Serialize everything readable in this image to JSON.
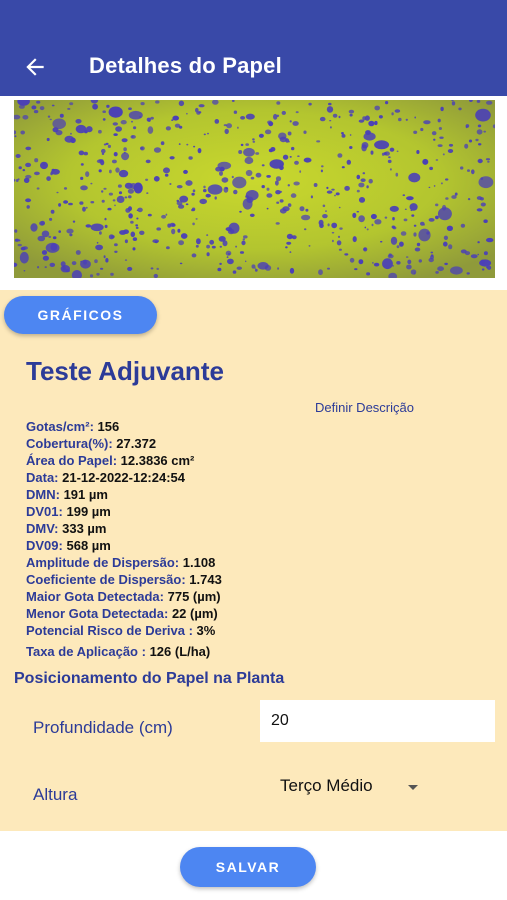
{
  "appbar": {
    "title": "Detalhes do Papel",
    "back_icon": "arrow-left-icon",
    "color": "#3949a8"
  },
  "photo": {
    "description_colors": {
      "background": "#b4c830",
      "droplets": "#4a3fb8"
    }
  },
  "charts_button": {
    "label": "GRÁFICOS"
  },
  "test_name": "Teste Adjuvante",
  "description_link": "Definir Descrição",
  "stats": [
    {
      "label": "Gotas/cm²:",
      "value": "156"
    },
    {
      "label": "Cobertura(%):",
      "value": "27.372"
    },
    {
      "label": "Área do Papel:",
      "value": "12.3836 cm²"
    },
    {
      "label": "Data:",
      "value": "21-12-2022-12:24:54"
    },
    {
      "label": "DMN:",
      "value": "191 µm"
    },
    {
      "label": "DV01:",
      "value": "199 µm"
    },
    {
      "label": "DMV:",
      "value": "333 µm"
    },
    {
      "label": "DV09:",
      "value": "568 µm"
    },
    {
      "label": "Amplitude de Dispersão:",
      "value": "1.108"
    },
    {
      "label": "Coeficiente de Dispersão:",
      "value": "1.743"
    },
    {
      "label": "Maior Gota Detectada:",
      "value": "775 (µm)"
    },
    {
      "label": "Menor Gota Detectada:",
      "value": "22 (µm)"
    },
    {
      "label": "Potencial Risco de Deriva :",
      "value": "3%"
    },
    {
      "label": "Taxa de Aplicação :",
      "value": "126 (L/ha)"
    }
  ],
  "positioning": {
    "title": "Posicionamento do Papel na Planta",
    "depth_label": "Profundidade (cm)",
    "depth_value": "20",
    "height_label": "Altura",
    "height_value": "Terço Médio"
  },
  "save_button": {
    "label": "SALVAR"
  },
  "colors": {
    "accent": "#4d86f2",
    "panel": "#fde9bb",
    "text_blue": "#2c3b98"
  }
}
